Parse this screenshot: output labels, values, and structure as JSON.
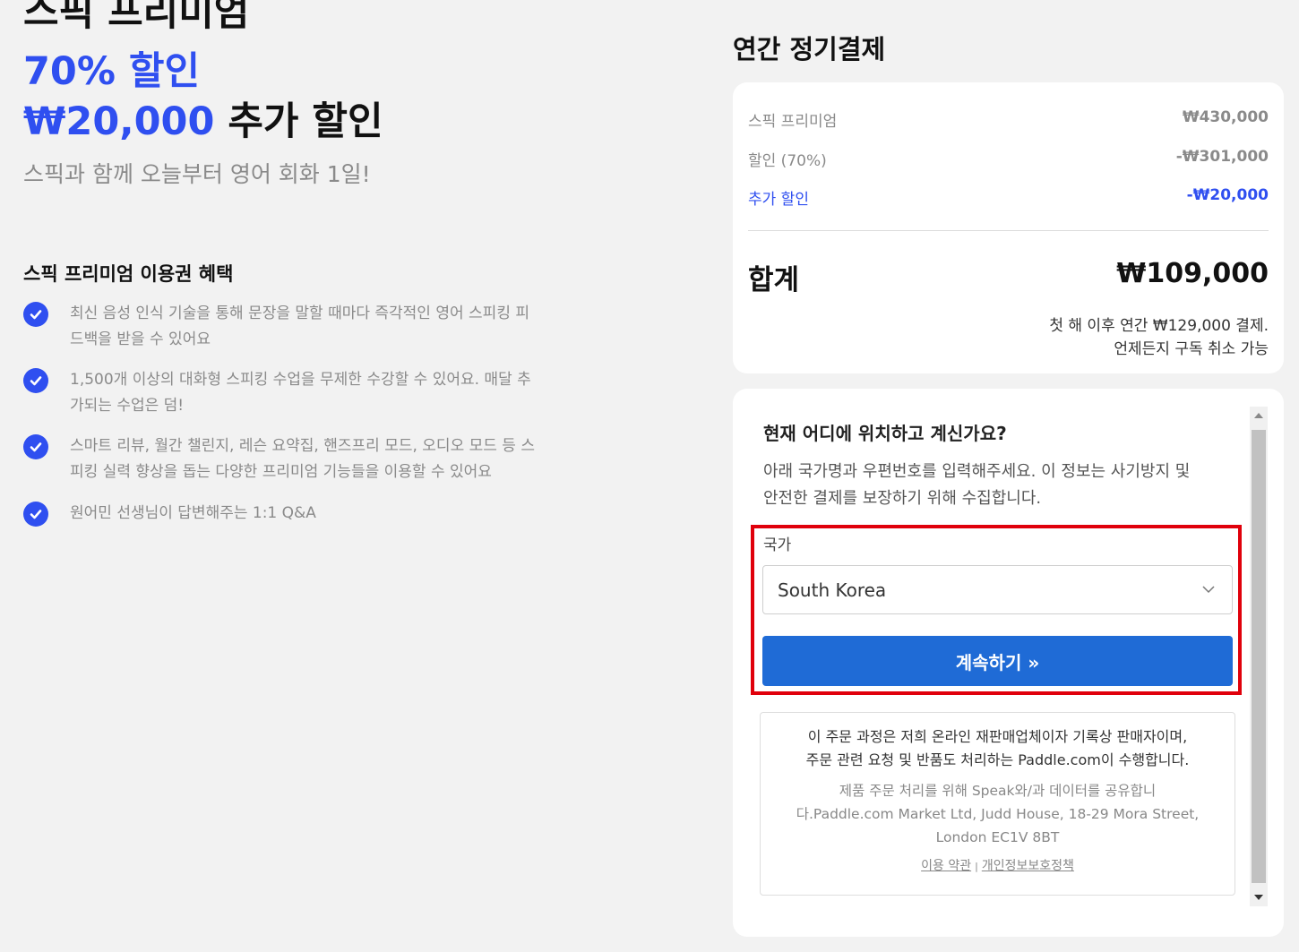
{
  "hero": {
    "title": "스픽 프리미엄",
    "discount": "70% 할인",
    "extra_amount": "₩20,000",
    "extra_label": " 추가 할인",
    "subtitle": "스픽과 함께 오늘부터 영어 회화 1일!"
  },
  "benefits": {
    "title": "스픽 프리미엄 이용권 혜택",
    "items": [
      {
        "line1": "최신 음성 인식 기술을 통해 문장을 말할 때마다 즉각적인 영어 스피킹 피",
        "line2": "드백을 받을 수 있어요"
      },
      {
        "line1": "1,500개 이상의 대화형 스피킹 수업을 무제한 수강할 수 있어요. 매달 추",
        "line2": "가되는 수업은 덤!"
      },
      {
        "line1": "스마트 리뷰, 월간 챌린지, 레슨 요약집, 핸즈프리 모드, 오디오 모드 등 스",
        "line2": "피킹 실력 향상을 돕는 다양한 프리미엄 기능들을 이용할 수 있어요"
      },
      {
        "line1": "원어민 선생님이 답변해주는 1:1 Q&A",
        "line2": ""
      }
    ]
  },
  "plan": {
    "title": "연간 정기결제",
    "rows": [
      {
        "label": "스픽 프리미엄",
        "value": "₩430,000"
      },
      {
        "label": "할인 (70%)",
        "value": "-₩301,000"
      },
      {
        "label": "추가 할인",
        "value": "-₩20,000"
      }
    ],
    "total_label": "합계",
    "total_value": "₩109,000",
    "note_line1": "첫 해 이후 연간 ₩129,000 결제.",
    "note_line2": "언제든지 구독 취소 가능"
  },
  "checkout": {
    "question": "현재 어디에 위치하고 계신가요?",
    "description_line1": "아래 국가명과 우편번호를 입력해주세요. 이 정보는 사기방지 및",
    "description_line2": "안전한 결제를 보장하기 위해 수집합니다.",
    "country_label": "국가",
    "country_value": "South Korea",
    "continue_button": "계속하기 »",
    "legal_main_line1": "이 주문 과정은 저희 온라인 재판매업체이자 기록상 판매자이며,",
    "legal_main_line2": "주문 관련 요청 및 반품도 처리하는 Paddle.com이 수행합니다.",
    "legal_sub_line1": "제품 주문 처리를 위해 Speak와/과 데이터를 공유합니",
    "legal_sub_line2": "다.Paddle.com Market Ltd, Judd House, 18-29 Mora Street,",
    "legal_sub_line3": "London EC1V 8BT",
    "terms_link": "이용 약관",
    "separator": "|",
    "privacy_link": "개인정보보호정책"
  },
  "colors": {
    "accent_blue": "#2f4ff0",
    "button_blue": "#1f6bd6",
    "highlight_red": "#e0000b",
    "background": "#f2f2f2"
  },
  "icons": [
    "check-circle-icon",
    "chevron-down-icon",
    "scroll-up-arrow-icon",
    "scroll-down-arrow-icon"
  ]
}
